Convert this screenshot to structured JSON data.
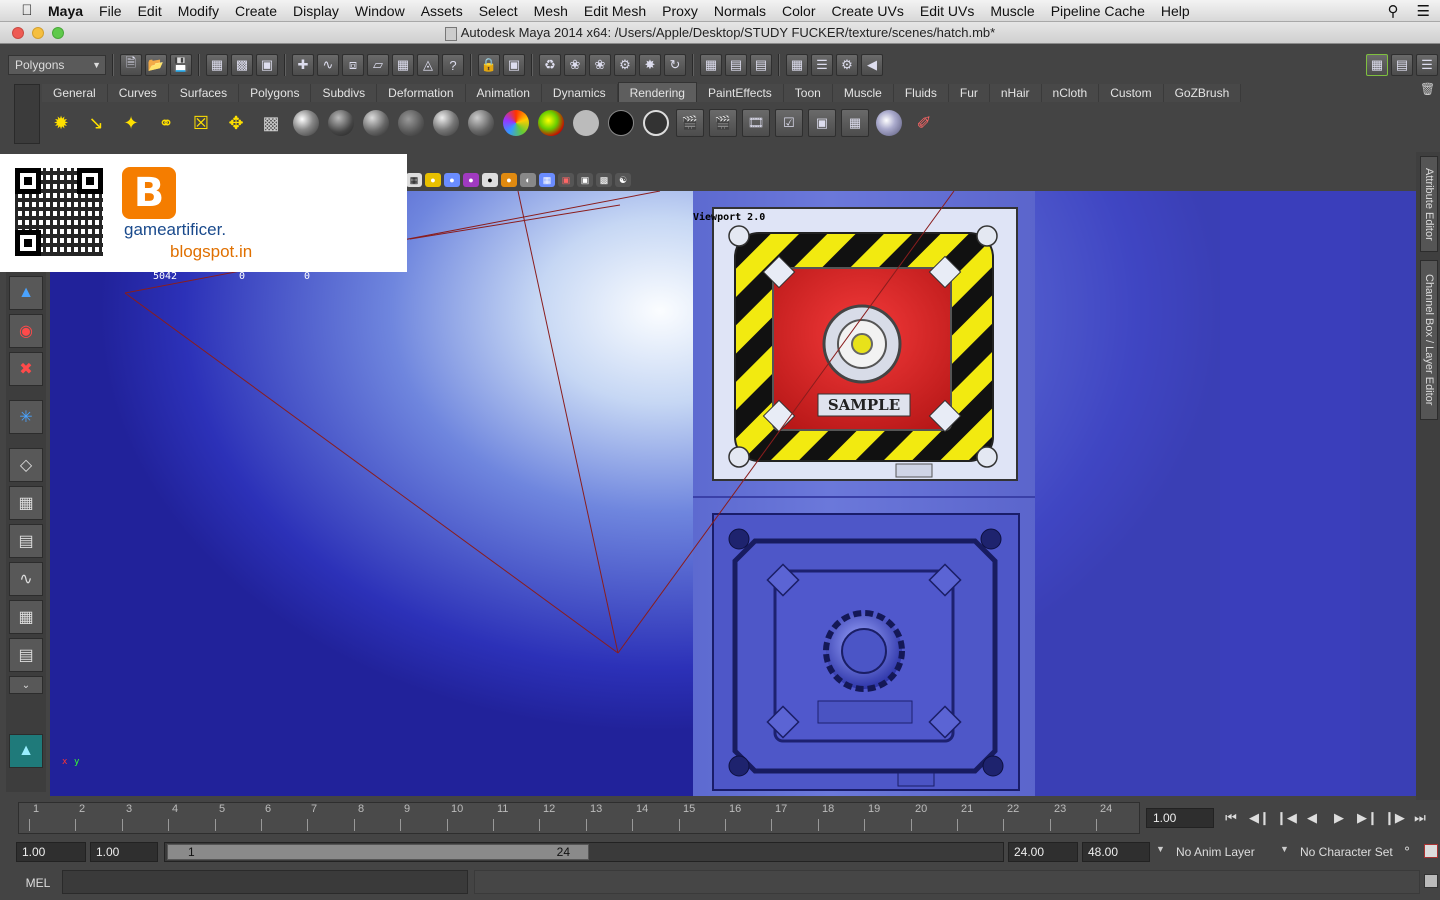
{
  "menubar": {
    "app": "Maya",
    "items": [
      "File",
      "Edit",
      "Modify",
      "Create",
      "Display",
      "Window",
      "Assets",
      "Select",
      "Mesh",
      "Edit Mesh",
      "Proxy",
      "Normals",
      "Color",
      "Create UVs",
      "Edit UVs",
      "Muscle",
      "Pipeline Cache",
      "Help"
    ]
  },
  "window": {
    "title": "Autodesk Maya 2014 x64: /Users/Apple/Desktop/STUDY FUCKER/texture/scenes/hatch.mb*"
  },
  "statusline": {
    "menu_set": "Polygons"
  },
  "shelf": {
    "tabs": [
      "General",
      "Curves",
      "Surfaces",
      "Polygons",
      "Subdivs",
      "Deformation",
      "Animation",
      "Dynamics",
      "Rendering",
      "PaintEffects",
      "Toon",
      "Muscle",
      "Fluids",
      "Fur",
      "nHair",
      "nCloth",
      "Custom",
      "GoZBrush"
    ],
    "active": "Rendering"
  },
  "viewport": {
    "label": "Viewport 2.0",
    "stats": [
      "5042",
      "0",
      "0"
    ],
    "sample_text": "SAMPLE",
    "axis_x": "x",
    "axis_y": "y"
  },
  "overlay": {
    "site_line1": "gameartificer.",
    "site_line2": "blogspot.in"
  },
  "side_tabs": {
    "attribute_editor": "Attribute Editor",
    "channel_box": "Channel Box / Layer Editor"
  },
  "timeline": {
    "ticks": [
      "1",
      "2",
      "3",
      "4",
      "5",
      "6",
      "7",
      "8",
      "9",
      "10",
      "11",
      "12",
      "13",
      "14",
      "15",
      "16",
      "17",
      "18",
      "19",
      "20",
      "21",
      "22",
      "23",
      "24"
    ],
    "current_frame": "1.00"
  },
  "range": {
    "start": "1.00",
    "start2": "1.00",
    "slider_start": "1",
    "slider_end": "24",
    "end": "24.00",
    "end2": "48.00",
    "anim_layer": "No Anim Layer",
    "char_set": "No Character Set"
  },
  "cmdline": {
    "label": "MEL"
  }
}
